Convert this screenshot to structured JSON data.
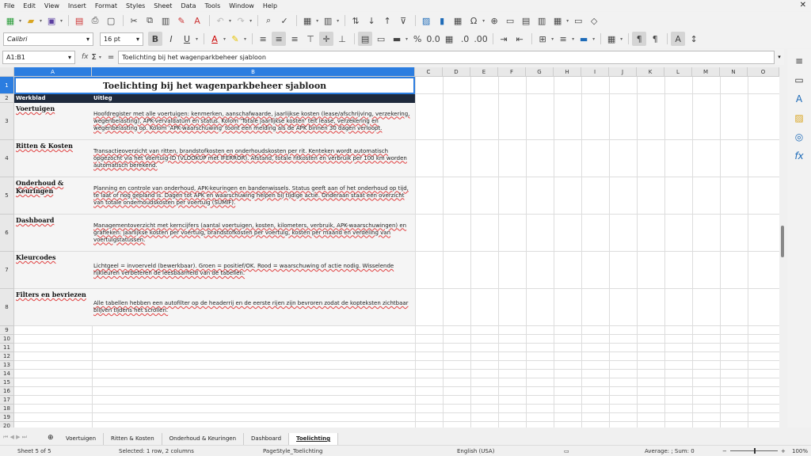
{
  "menu": [
    "File",
    "Edit",
    "View",
    "Insert",
    "Format",
    "Styles",
    "Sheet",
    "Data",
    "Tools",
    "Window",
    "Help"
  ],
  "font": {
    "name": "Calibri",
    "size": "16 pt"
  },
  "formula": {
    "cell_ref": "A1:B1",
    "content": "Toelichting bij het wagenparkbeheer sjabloon"
  },
  "columns": [
    "A",
    "B",
    "C",
    "D",
    "E",
    "F",
    "G",
    "H",
    "I",
    "J",
    "K",
    "L",
    "M",
    "N",
    "O"
  ],
  "rows": [
    "1",
    "2",
    "3",
    "4",
    "5",
    "6",
    "7",
    "8",
    "9",
    "10",
    "11",
    "12",
    "13",
    "14",
    "15",
    "16",
    "17",
    "18",
    "19",
    "20"
  ],
  "sheet": {
    "title": "Toelichting bij het wagenparkbeheer sjabloon",
    "header": {
      "a": "Werkblad",
      "b": "Uitleg"
    },
    "entries": [
      {
        "a": "Voertuigen",
        "b": "Hoofdregister met alle voertuigen: kenmerken, aanschafwaarde, jaarlijkse kosten (lease/afschrijving, verzekering, wegenbelasting), APK-vervaldatum en status. Kolom 'Totale jaarlijkse kosten' telt lease, verzekering en wegenbelasting op. Kolom 'APK-waarschuwing' toont een melding als de APK binnen 30 dagen verloopt."
      },
      {
        "a": "Ritten & Kosten",
        "b": "Transactieoverzicht van ritten, brandstofkosten en onderhoudskosten per rit. Kenteken wordt automatisch opgezocht via het Voertuig-ID (VLOOKUP met IFERROR). Afstand, totale ritkosten en verbruik per 100 km worden automatisch berekend."
      },
      {
        "a": "Onderhoud & Keuringen",
        "b": "Planning en controle van onderhoud, APK-keuringen en bandenwissels. Status geeft aan of het onderhoud op tijd, te laat of nog gepland is. Dagen tot APK en waarschuwing helpen bij tijdige actie. Onderaan staat een overzicht van totale onderhoudskosten per voertuig (SUMIF)."
      },
      {
        "a": "Dashboard",
        "b": "Managementoverzicht met kerncijfers (aantal voertuigen, kosten, kilometers, verbruik, APK-waarschuwingen) en grafieken: jaarlijkse kosten per voertuig, brandstofkosten per voertuig, kosten per maand en verdeling van voertuigstatussen."
      },
      {
        "a": "Kleurcodes",
        "b": "Lichtgeel = invoerveld (bewerkbaar). Groen = positief/OK. Rood = waarschuwing of actie nodig. Wisselende rijkleuren verbeteren de leesbaarheid van de tabellen."
      },
      {
        "a": "Filters en bevriezen",
        "b": "Alle tabellen hebben een autofilter op de headerrij en de eerste rijen zijn bevroren zodat de kopteksten zichtbaar blijven tijdens het scrollen."
      }
    ]
  },
  "tabs": [
    "Voertuigen",
    "Ritten & Kosten",
    "Onderhoud & Keuringen",
    "Dashboard",
    "Toelichting"
  ],
  "status": {
    "sheet": "Sheet 5 of 5",
    "selection": "Selected: 1 row, 2 columns",
    "page_style": "PageStyle_Toelichting",
    "language": "English (USA)",
    "sum": "Average: ; Sum: 0",
    "zoom": "100%"
  }
}
